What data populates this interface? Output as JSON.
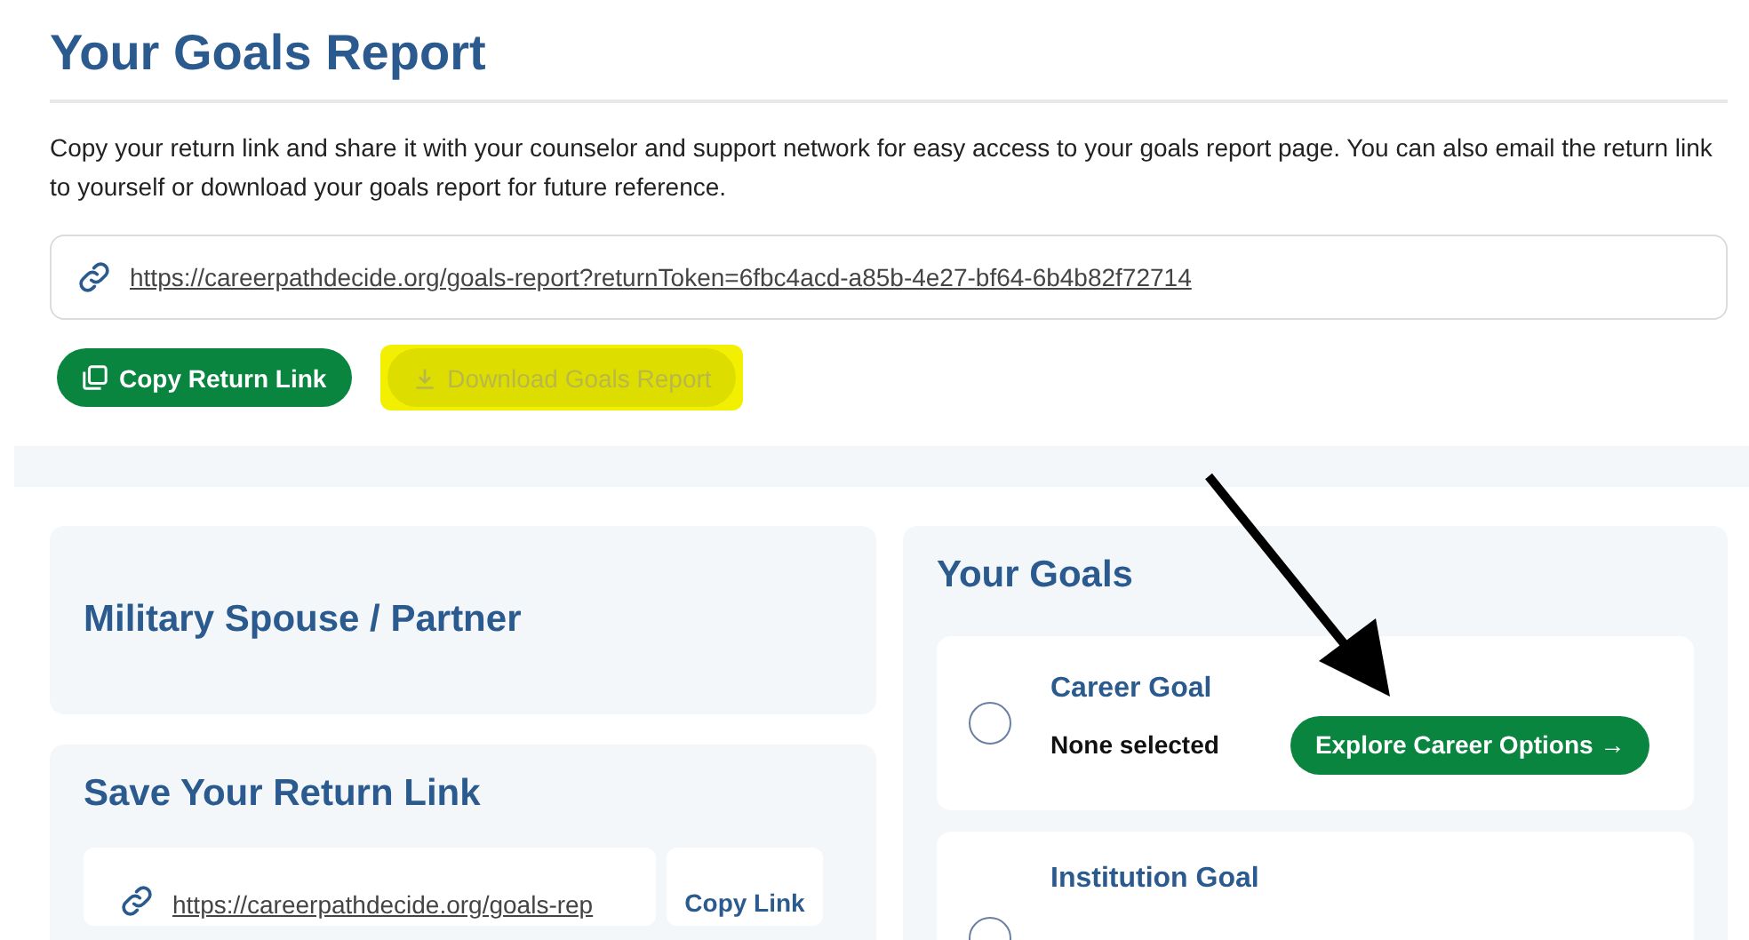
{
  "page": {
    "title": "Your Goals Report",
    "intro": "Copy your return link and share it with your counselor and support network for easy access to your goals report page. You can also email the return link to yourself or download your goals report for future reference.",
    "return_link": "https://careerpathdecide.org/goals-report?returnToken=6fbc4acd-a85b-4e27-bf64-6b4b82f72714",
    "buttons": [
      {
        "label": "Copy Return Link",
        "kind": "primary",
        "highlighted": false
      },
      {
        "label": "Download Goals Report",
        "kind": "disabled",
        "highlighted": true
      }
    ]
  },
  "left_cards": [
    {
      "title": "Military Spouse / Partner"
    },
    {
      "title": "Save Your Return Link",
      "link": "https://careerpathdecide.org/goals-rep",
      "action": "Copy Link"
    }
  ],
  "goals": {
    "title": "Your Goals",
    "items": [
      {
        "title": "Career Goal",
        "value": "None selected",
        "selected": false,
        "action": "Explore Career Options →"
      },
      {
        "title": "Institution Goal",
        "selected": false
      }
    ]
  },
  "annotations": [
    {
      "kind": "arrow"
    }
  ]
}
